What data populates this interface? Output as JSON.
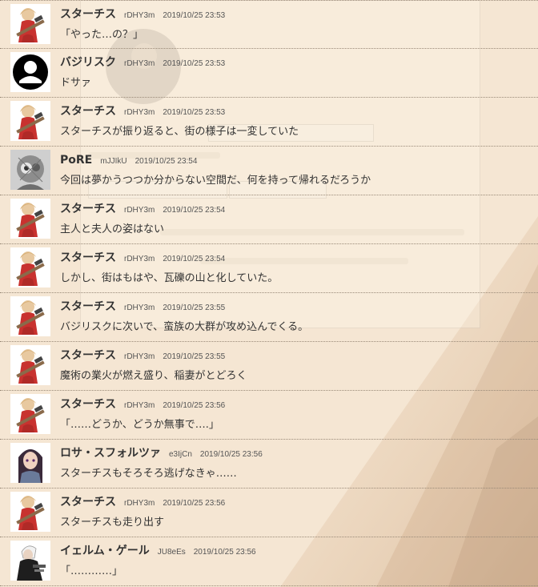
{
  "colors": {
    "page_background": "#f5e6d3",
    "text": "#333333",
    "meta_text": "#555555",
    "divider": "#9a8a78"
  },
  "messages": [
    {
      "avatar": "starchis-avatar",
      "name": "スターチス",
      "id": "rDHY3m",
      "time": "2019/10/25 23:53",
      "text": "「やった…の？」"
    },
    {
      "avatar": "default-user-icon",
      "name": "バジリスク",
      "id": "rDHY3m",
      "time": "2019/10/25 23:53",
      "text": "ドサァ"
    },
    {
      "avatar": "starchis-avatar",
      "name": "スターチス",
      "id": "rDHY3m",
      "time": "2019/10/25 23:53",
      "text": "スターチスが振り返ると、街の様子は一変していた"
    },
    {
      "avatar": "pore-avatar",
      "name": "PoRE",
      "id": "mJJIkU",
      "time": "2019/10/25 23:54",
      "text": "今回は夢かうつつか分からない空間だ、何を持って帰れるだろうか"
    },
    {
      "avatar": "starchis-avatar",
      "name": "スターチス",
      "id": "rDHY3m",
      "time": "2019/10/25 23:54",
      "text": "主人と夫人の姿はない"
    },
    {
      "avatar": "starchis-avatar",
      "name": "スターチス",
      "id": "rDHY3m",
      "time": "2019/10/25 23:54",
      "text": "しかし、街はもはや、瓦礫の山と化していた。"
    },
    {
      "avatar": "starchis-avatar",
      "name": "スターチス",
      "id": "rDHY3m",
      "time": "2019/10/25 23:55",
      "text": "バジリスクに次いで、蛮族の大群が攻め込んでくる。"
    },
    {
      "avatar": "starchis-avatar",
      "name": "スターチス",
      "id": "rDHY3m",
      "time": "2019/10/25 23:55",
      "text": "魔術の業火が燃え盛り、稲妻がとどろく"
    },
    {
      "avatar": "starchis-avatar",
      "name": "スターチス",
      "id": "rDHY3m",
      "time": "2019/10/25 23:56",
      "text": "「……どうか、どうか無事で….」"
    },
    {
      "avatar": "rosa-avatar",
      "name": "ロサ・スフォルツァ",
      "id": "e3IjCn",
      "time": "2019/10/25 23:56",
      "text": "スターチスもそろそろ逃げなきゃ……"
    },
    {
      "avatar": "starchis-avatar",
      "name": "スターチス",
      "id": "rDHY3m",
      "time": "2019/10/25 23:56",
      "text": "スターチスも走り出す"
    },
    {
      "avatar": "yerm-avatar",
      "name": "イェルム・ゲール",
      "id": "JU8eEs",
      "time": "2019/10/25 23:56",
      "text": "「…………」"
    }
  ]
}
